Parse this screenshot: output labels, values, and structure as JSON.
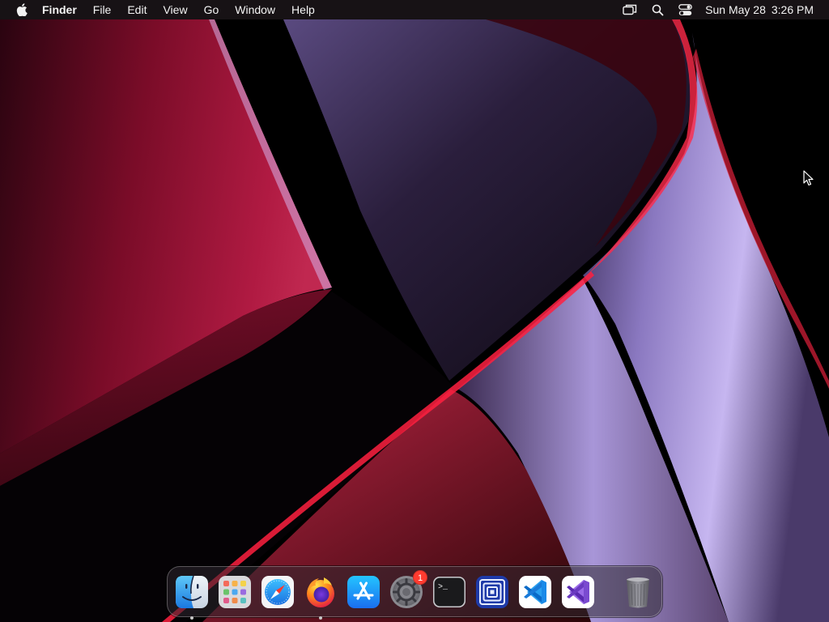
{
  "menubar": {
    "apple_icon": "apple-logo-icon",
    "app_name": "Finder",
    "menus": [
      "File",
      "Edit",
      "View",
      "Go",
      "Window",
      "Help"
    ],
    "status_icons": [
      "screen-mirroring-icon",
      "spotlight-search-icon",
      "control-center-icon"
    ],
    "clock": {
      "date": "Sun May 28",
      "time": "3:26 PM"
    }
  },
  "dock": {
    "apps": [
      {
        "icon": "finder-icon",
        "running": true
      },
      {
        "icon": "launchpad-icon",
        "running": false
      },
      {
        "icon": "safari-icon",
        "running": false
      },
      {
        "icon": "firefox-icon",
        "running": true
      },
      {
        "icon": "app-store-icon",
        "running": false
      },
      {
        "icon": "system-settings-icon",
        "running": false,
        "badge": "1"
      },
      {
        "icon": "terminal-icon",
        "running": false,
        "label": ">_"
      },
      {
        "icon": "concentric-squares-app-icon",
        "running": false
      },
      {
        "icon": "vscode-icon",
        "running": false
      },
      {
        "icon": "visual-studio-icon",
        "running": false
      }
    ],
    "trash": {
      "icon": "trash-icon"
    }
  },
  "colors": {
    "menubar_bg": "#1c161a",
    "badge": "#ff3b30",
    "wallpaper_red": "#8a1030",
    "wallpaper_lavender": "#b8a8e8"
  }
}
